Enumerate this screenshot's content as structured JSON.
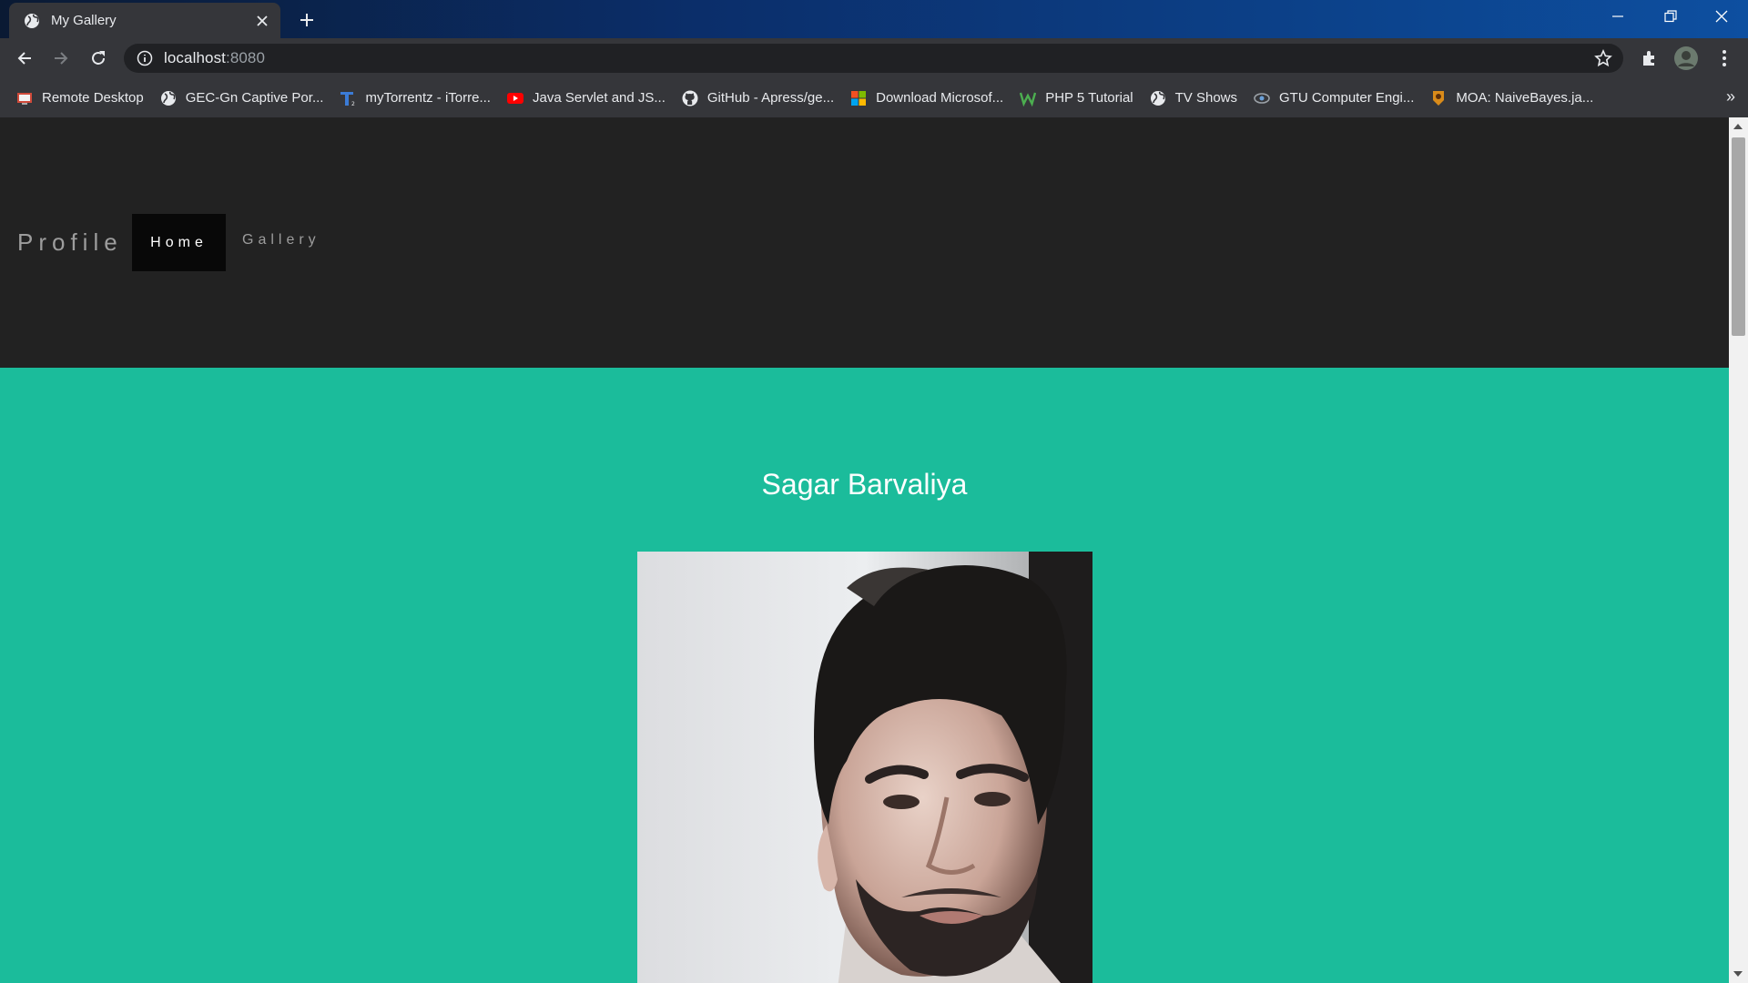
{
  "browser": {
    "tab_title": "My Gallery",
    "url_host": "localhost",
    "url_port": ":8080",
    "bookmarks": [
      {
        "label": "Remote Desktop",
        "icon": "remote-desktop-icon"
      },
      {
        "label": "GEC-Gn Captive Por...",
        "icon": "globe-icon"
      },
      {
        "label": "myTorrentz - iTorre...",
        "icon": "torrentz-icon"
      },
      {
        "label": "Java Servlet and JS...",
        "icon": "youtube-icon"
      },
      {
        "label": "GitHub - Apress/ge...",
        "icon": "github-icon"
      },
      {
        "label": "Download Microsof...",
        "icon": "microsoft-icon"
      },
      {
        "label": "PHP 5 Tutorial",
        "icon": "w3schools-icon"
      },
      {
        "label": "TV Shows",
        "icon": "globe-icon"
      },
      {
        "label": "GTU Computer Engi...",
        "icon": "gtu-icon"
      },
      {
        "label": "MOA: NaiveBayes.ja...",
        "icon": "moa-icon"
      }
    ],
    "more_label": "»"
  },
  "navbar": {
    "brand": "Profile",
    "links": [
      "Home",
      "Gallery"
    ],
    "active": "Home"
  },
  "hero": {
    "name": "Sagar Barvaliya",
    "photo_icon": "profile-photo"
  },
  "colors": {
    "navbar_bg": "#222222",
    "page_bg": "#1bbc9b",
    "active_link_bg": "#080808"
  }
}
